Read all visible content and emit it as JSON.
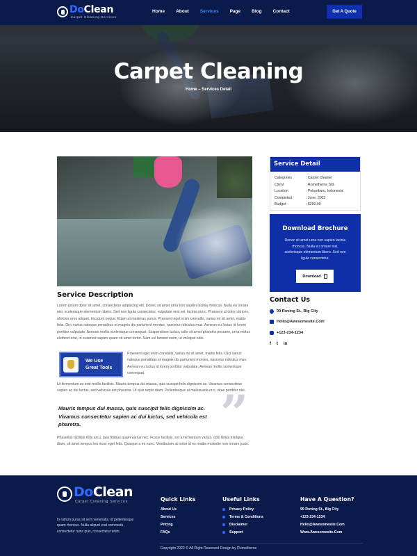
{
  "brand": {
    "name_prefix": "Do",
    "name_suffix": "Clean",
    "tagline": "Carpet Cleaning Services"
  },
  "nav": {
    "items": [
      "Home",
      "About",
      "Services",
      "Page",
      "Blog",
      "Contact"
    ],
    "active": "Services",
    "cta": "Get A Quote"
  },
  "hero": {
    "title": "Carpet Cleaning",
    "breadcrumb": "Home – Services Detail"
  },
  "main": {
    "section_title": "Service Description",
    "para1": "Lorem ipsum dolor sit amet, consectetur adipiscing elit. Donec sit amet urna non sapien lacinia rhoncus. Nulla eu ornare nisi, scelerisque elementum libero. Sed non ligula consectetur, vulputate erat vel, lacinia nunc. Praesent ut dolor ultrices, ultricies eros aliquet, tincidunt neque. Etiam ut maximus purus. Praesent eget enim convallis, varius mi sit amet, mattis felis. Orci varius natoque penatibus et magnis dis parturient montes, nascetur ridiculus mus. Aenean eu luctus id lorem porttitor vulputate. Aenean mollis scelerisque consequat. Suspendisse luctus, odio sit amet pharetra posuere, urna metus eleifend erat, in euismod sapien quam sit amet tortor. Nam vel laoreet enim, ut volutpat odio.",
    "tools_line1": "We Use",
    "tools_line2": "Great Tools",
    "para2": "Praesent eget enim convallis, varius mi sit amet, mattis felis. Orci varius natoque penatibus et magnis dis parturient montes, nascetur ridiculus mus. Aenean eu luctus id lorem porttitor vulputate. Aenean mollis scelerisque consequat.",
    "para3": "Ut fermentum ex erat mollis facilisis. Mauris tempus dui massa, quis suscipit felis dignissim ac. Vivamus consectetur sapien ac dui luctus, sed vehicula est pharetra. Ut quis turpis diam. Pellentesque at malesuada orci, vitae porttitor nisi.",
    "quote": "Mauris tempus dui massa, quis suscipit felis dignissim ac. Vivamus consectetur sapien ac dui luctus, sed vehicula est pharetra.",
    "quote_mark": "”",
    "para4": "Phasellus facilisis felis arcu, quis finibus quam varius nec. Fusce facilisis, est a fermentum varius, odio tellus tristique diam, sit amet tempus leo risus eget felis. Quisque a mi nunc. Vestibulum at tortor id ex mattis molestie non ornare justo."
  },
  "sidebar": {
    "detail_title": "Service Detail",
    "details": [
      {
        "key": "Categories",
        "value": ": Carpet Cleaner"
      },
      {
        "key": "Client",
        "value": ": Rometheme Std."
      },
      {
        "key": "Location",
        "value": ": Pekanbaru, Indonesia"
      },
      {
        "key": "Completed",
        "value": ": June, 2022"
      },
      {
        "key": "Budget",
        "value": ": $200.00"
      }
    ],
    "brochure_title": "Download Brochure",
    "brochure_text": "Donec sit amet urna non sapien lacinia rhoncus. Nulla eu ornare nisi, scelerisque elementum libero. Sed non ligula consectetur.",
    "download_label": "Download",
    "contact_title": "Contact Us",
    "address": "99 Roving St., Big City",
    "email": "Hello@Awesomesite.Com",
    "phone": "+123-234-1234",
    "socials": [
      "f",
      "t",
      "in"
    ]
  },
  "footer": {
    "about": "In rutrum purus sit sem venenatis, id pellentesque quam rhoncus. Nulla aliquet erat commodo, consectetur nunc quis, consectetur enim.",
    "quick_links_title": "Quick Links",
    "quick_links": [
      "About Us",
      "Services",
      "Pricing",
      "FAQs"
    ],
    "useful_links_title": "Useful Links",
    "useful_links": [
      "Privacy Policy",
      "Terms & Conditions",
      "Disclaimer",
      "Support"
    ],
    "question_title": "Have A Question?",
    "question_items": [
      "99 Roving St., Big City",
      "+123-234-1234",
      "Hello@Awesomesite.Com",
      "Www.Awesomesite.Com"
    ],
    "copyright": "Copyright 2022 © All Right Reserved Design by Rometheme"
  },
  "colors": {
    "navy": "#0a1a4a",
    "brand_blue": "#0f2fa8",
    "accent_blue": "#2f6bff"
  },
  "icons": {
    "address": "map-pin-icon",
    "email": "mail-icon",
    "phone": "phone-icon",
    "download": "file-icon"
  }
}
